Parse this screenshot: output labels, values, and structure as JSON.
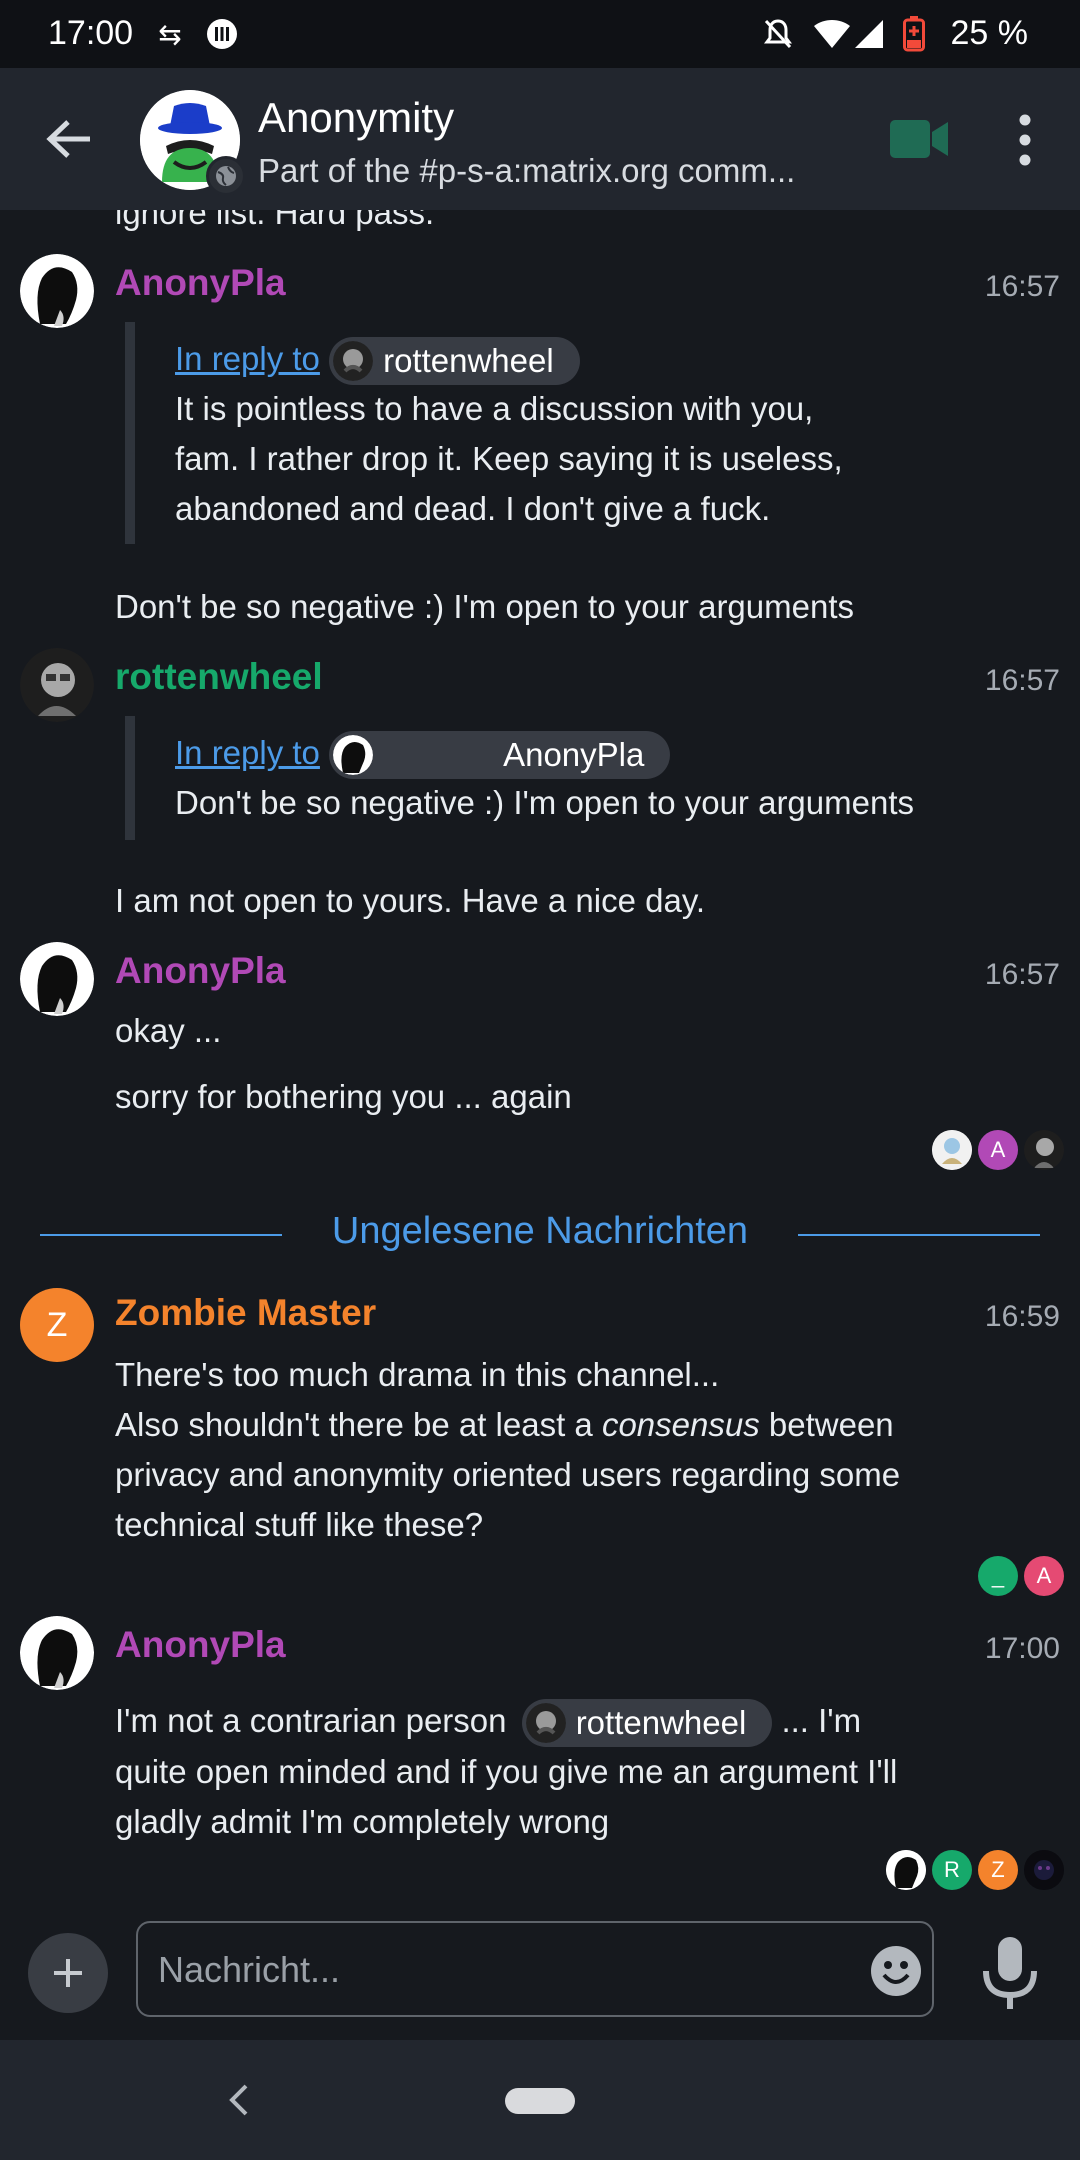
{
  "status_bar": {
    "time": "17:00",
    "battery": "25 %",
    "icons": [
      "data-sync-icon",
      "signal-app-icon",
      "bell-off-icon",
      "wifi-icon",
      "cell-signal-icon",
      "battery-icon"
    ]
  },
  "header": {
    "title": "Anonymity",
    "topic": "Part of the #p-s-a:matrix.org comm...",
    "icons": [
      "back-arrow-icon",
      "video-call-icon",
      "more-vert-icon"
    ]
  },
  "timeline": {
    "cut_text": "ignore list. Hard pass.",
    "messages": [
      {
        "sender": "AnonyPla",
        "time": "16:57",
        "reply": {
          "label": "In reply to",
          "user": "rottenwheel",
          "text": [
            "It is pointless to have a discussion with you,",
            "fam. I rather drop it. Keep saying it is useless,",
            "abandoned and dead. I don't give a fuck."
          ]
        },
        "body": "Don't be so negative :) I'm open to your arguments"
      },
      {
        "sender": "rottenwheel",
        "time": "16:57",
        "reply": {
          "label": "In reply to",
          "user": "AnonyPla",
          "text": [
            "Don't be so negative :) I'm open to your arguments"
          ]
        },
        "body": "I am not open to yours. Have a nice day."
      },
      {
        "sender": "AnonyPla",
        "time": "16:57",
        "body_lines": [
          "okay ...",
          "sorry for bothering you ... again"
        ],
        "receipts": [
          "",
          "A",
          ""
        ]
      },
      {
        "sender": "Zombie Master",
        "avatar_letter": "Z",
        "time": "16:59",
        "body_line1": "There's too much drama in this channel...",
        "body_line2_pre": "Also shouldn't there be at least a ",
        "body_line2_em": "consensus",
        "body_line2_post": " between",
        "body_line3": "privacy and anonymity oriented users regarding some",
        "body_line4": "technical stuff like these?",
        "receipts": [
          "_",
          "A"
        ]
      },
      {
        "sender": "AnonyPla",
        "time": "17:00",
        "body_pre": "I'm not a contrarian person",
        "mention": "rottenwheel",
        "body_post": " ... I'm",
        "body_line2": "quite open minded and if you give me an argument I'll",
        "body_line3": "gladly admit I'm completely wrong",
        "receipts": [
          "",
          "R",
          "Z",
          ""
        ]
      }
    ],
    "divider": "Ungelesene Nachrichten"
  },
  "composer": {
    "placeholder": "Nachricht...",
    "icons": [
      "add-icon",
      "emoji-icon",
      "microphone-icon"
    ]
  },
  "colors": {
    "background": "#16191e",
    "header": "#22262e",
    "accent_blue": "#4c9be8",
    "anonypla": "#b149b6",
    "rottenwheel": "#16a96b",
    "zombie": "#f4832c"
  }
}
